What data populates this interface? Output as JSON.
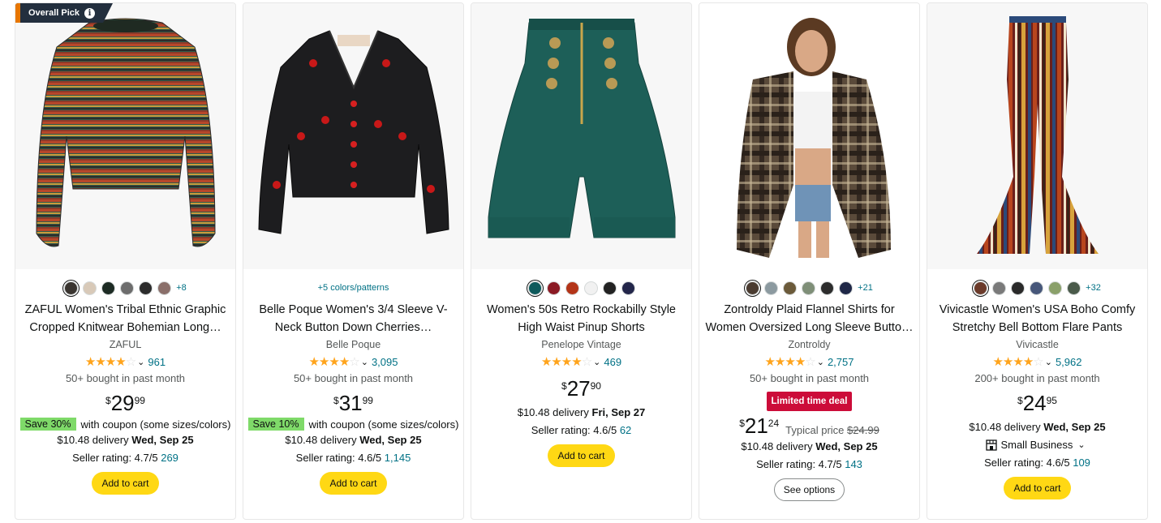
{
  "badge": {
    "label": "Overall Pick",
    "info": "i"
  },
  "products": [
    {
      "swatches": [
        "#3a3530",
        "#d8c9b8",
        "#1d2b24",
        "#6d6d6d",
        "#2c2c2c",
        "#8a6f6a"
      ],
      "more_colors": "+8",
      "title": "ZAFUL Women's Tribal Ethnic Graphic Cropped Knitwear Bohemian Long…",
      "brand": "ZAFUL",
      "stars": 4.0,
      "star_glyphs": "★★★★",
      "star_empty": "☆",
      "review_count": "961",
      "bought": "50+ bought in past month",
      "price_symbol": "$",
      "price_whole": "29",
      "price_fraction": "99",
      "coupon_save": "Save 30%",
      "coupon_text": "with coupon (some sizes/colors)",
      "delivery_prefix": "$10.48 delivery",
      "delivery_date": "Wed, Sep 25",
      "seller_rating": "Seller rating: 4.7/5",
      "seller_count": "269",
      "button": "Add to cart"
    },
    {
      "colors_link": "+5 colors/patterns",
      "title": "Belle Poque Women's 3/4 Sleeve V-Neck Button Down Cherries…",
      "brand": "Belle Poque",
      "stars": 4.5,
      "star_glyphs": "★★★★",
      "star_empty": "☆",
      "review_count": "3,095",
      "bought": "50+ bought in past month",
      "price_symbol": "$",
      "price_whole": "31",
      "price_fraction": "99",
      "coupon_save": "Save 10%",
      "coupon_text": "with coupon (some sizes/colors)",
      "delivery_prefix": "$10.48 delivery",
      "delivery_date": "Wed, Sep 25",
      "seller_rating": "Seller rating: 4.6/5",
      "seller_count": "1,145",
      "button": "Add to cart"
    },
    {
      "swatches": [
        "#0e5a5c",
        "#8b1a24",
        "#b33418",
        "#f1f1f1",
        "#222222",
        "#23264a"
      ],
      "title": "Women's 50s Retro Rockabilly Style High Waist Pinup Shorts",
      "brand": "Penelope Vintage",
      "stars": 4.0,
      "star_glyphs": "★★★★",
      "star_empty": "☆",
      "review_count": "469",
      "price_symbol": "$",
      "price_whole": "27",
      "price_fraction": "90",
      "delivery_prefix": "$10.48 delivery",
      "delivery_date": "Fri, Sep 27",
      "seller_rating": "Seller rating: 4.6/5",
      "seller_count": "62",
      "button": "Add to cart"
    },
    {
      "swatches": [
        "#4a3b30",
        "#8c9aa0",
        "#6b5a3a",
        "#7f8f78",
        "#2d2d2d",
        "#1f2747"
      ],
      "more_colors": "+21",
      "title": "Zontroldy Plaid Flannel Shirts for Women Oversized Long Sleeve Butto…",
      "brand": "Zontroldy",
      "stars": 4.5,
      "star_glyphs": "★★★★",
      "star_empty": "☆",
      "review_count": "2,757",
      "bought": "50+ bought in past month",
      "deal": "Limited time deal",
      "price_symbol": "$",
      "price_whole": "21",
      "price_fraction": "24",
      "typical_label": "Typical price",
      "typical_price": "$24.99",
      "delivery_prefix": "$10.48 delivery",
      "delivery_date": "Wed, Sep 25",
      "seller_rating": "Seller rating: 4.7/5",
      "seller_count": "143",
      "button": "See options"
    },
    {
      "swatches": [
        "#6b3a2a",
        "#7a7a7a",
        "#2a2a2a",
        "#47577a",
        "#8aa06a",
        "#4a5a4a"
      ],
      "more_colors": "+32",
      "title": "Vivicastle Women's USA Boho Comfy Stretchy Bell Bottom Flare Pants",
      "brand": "Vivicastle",
      "stars": 4.0,
      "star_glyphs": "★★★★",
      "star_empty": "☆",
      "review_count": "5,962",
      "bought": "200+ bought in past month",
      "price_symbol": "$",
      "price_whole": "24",
      "price_fraction": "95",
      "delivery_prefix": "$10.48 delivery",
      "delivery_date": "Wed, Sep 25",
      "small_business": "Small Business",
      "seller_rating": "Seller rating: 4.6/5",
      "seller_count": "109",
      "button": "Add to cart"
    }
  ],
  "chevron": "⌵"
}
